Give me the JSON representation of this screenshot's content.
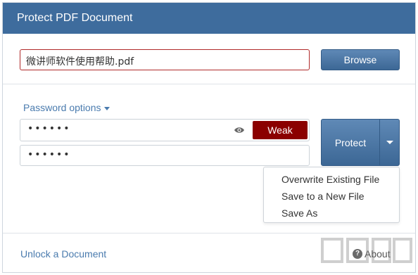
{
  "window": {
    "title": "Protect PDF Document"
  },
  "file": {
    "value": "微讲师软件使用帮助.pdf",
    "browse_label": "Browse"
  },
  "password": {
    "options_label": "Password options",
    "password_dots": "••••••",
    "confirm_dots": "••••••",
    "strength_label": "Weak",
    "strength_color": "#8b0000"
  },
  "protect": {
    "button_label": "Protect",
    "menu_items": [
      "Overwrite Existing File",
      "Save to a New File",
      "Save As"
    ]
  },
  "footer": {
    "unlock_label": "Unlock a Document",
    "about_label": "About"
  },
  "colors": {
    "accent": "#3e6c9d",
    "link": "#4a7bae"
  }
}
